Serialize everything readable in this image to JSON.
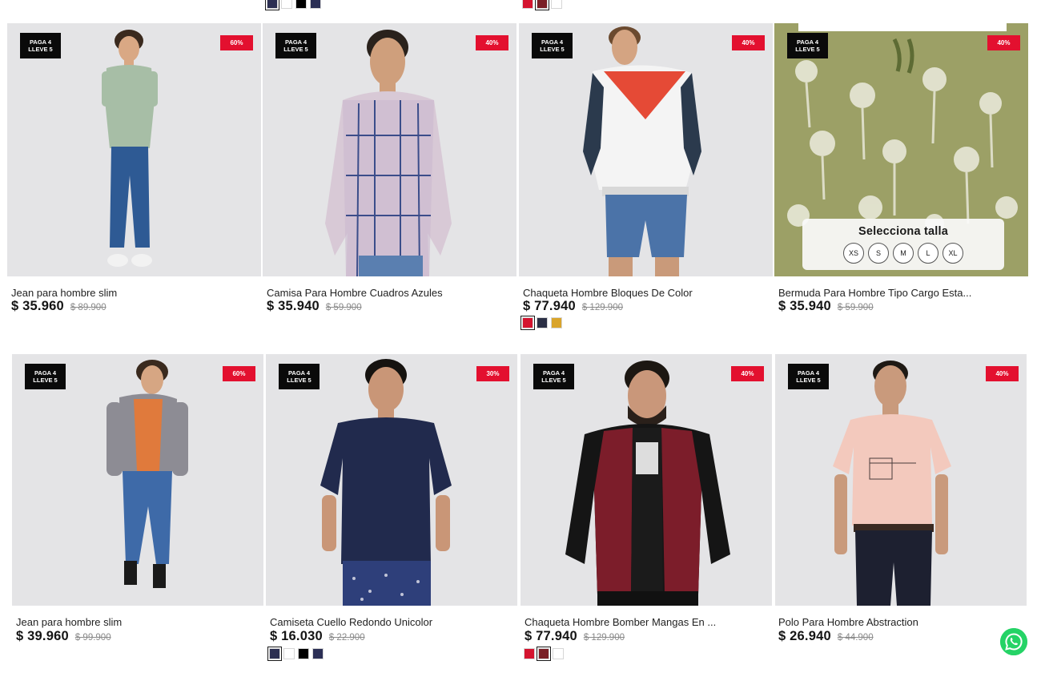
{
  "colors": {
    "discount_red": "#e3102f",
    "promo_black": "#0a0a0a",
    "image_bg": "#e4e4e6",
    "whatsapp_green": "#25d366"
  },
  "top_swatches": {
    "group_1": [
      "#2c2f52",
      "#ffffff",
      "#000000",
      "#2b2f55"
    ],
    "group_2": [
      "#d4142f",
      "#7a1f26",
      "#ffffff"
    ]
  },
  "products": [
    {
      "promo_line1": "PAGA 4",
      "promo_line2": "LLEVE 5",
      "discount": "60%",
      "name": "Jean para hombre slim",
      "price": "$ 35.960",
      "old_price": "$ 89.900",
      "swatches": []
    },
    {
      "promo_line1": "PAGA 4",
      "promo_line2": "LLEVE 5",
      "discount": "40%",
      "name": "Camisa Para Hombre Cuadros Azules",
      "price": "$ 35.940",
      "old_price": "$ 59.900",
      "swatches": []
    },
    {
      "promo_line1": "PAGA 4",
      "promo_line2": "LLEVE 5",
      "discount": "40%",
      "name": "Chaqueta Hombre Bloques De Color",
      "price": "$ 77.940",
      "old_price": "$ 129.900",
      "swatches": [
        "#d4142f",
        "#2b2f45",
        "#d9a42b"
      ]
    },
    {
      "promo_line1": "PAGA 4",
      "promo_line2": "LLEVE 5",
      "discount": "40%",
      "name": "Bermuda Para Hombre Tipo Cargo Esta...",
      "price": "$ 35.940",
      "old_price": "$ 59.900",
      "swatches": [],
      "size_selector": {
        "title": "Selecciona talla",
        "sizes": [
          "XS",
          "S",
          "M",
          "L",
          "XL"
        ]
      }
    },
    {
      "promo_line1": "PAGA 4",
      "promo_line2": "LLEVE 5",
      "discount": "60%",
      "name": "Jean para hombre slim",
      "price": "$ 39.960",
      "old_price": "$ 99.900",
      "swatches": []
    },
    {
      "promo_line1": "PAGA 4",
      "promo_line2": "LLEVE 5",
      "discount": "30%",
      "name": "Camiseta Cuello Redondo Unicolor",
      "price": "$ 16.030",
      "old_price": "$ 22.900",
      "swatches": [
        "#2c2f52",
        "#ffffff",
        "#000000",
        "#2b2f55"
      ]
    },
    {
      "promo_line1": "PAGA 4",
      "promo_line2": "LLEVE 5",
      "discount": "40%",
      "name": "Chaqueta Hombre Bomber Mangas En ...",
      "price": "$ 77.940",
      "old_price": "$ 129.900",
      "swatches": [
        "#d4142f",
        "#7a1f26",
        "#ffffff"
      ]
    },
    {
      "promo_line1": "PAGA 4",
      "promo_line2": "LLEVE 5",
      "discount": "40%",
      "name": "Polo Para Hombre Abstraction",
      "price": "$ 26.940",
      "old_price": "$ 44.900",
      "swatches": []
    }
  ]
}
